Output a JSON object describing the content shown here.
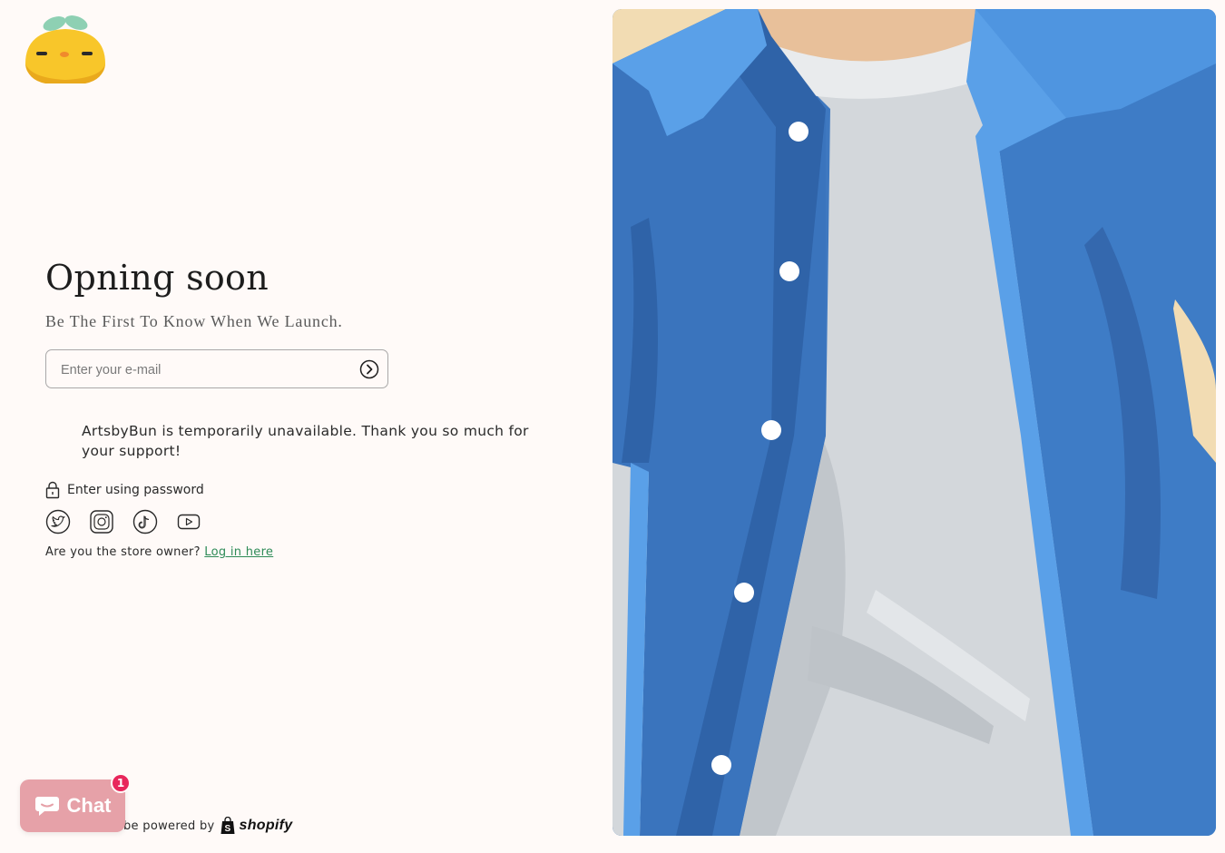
{
  "brand": {
    "logo_icon": "orange-bun-mascot-icon"
  },
  "header": {
    "title": "Opning soon",
    "subtitle": "Be The First To Know When We Launch."
  },
  "newsletter": {
    "placeholder": "Enter your e-mail",
    "submit_icon": "arrow-right-circle-icon"
  },
  "notice": {
    "text": "ArtsbyBun is temporarily unavailable. Thank you so much for your support!"
  },
  "password": {
    "label": "Enter using password",
    "icon": "lock-icon"
  },
  "socials": [
    {
      "name": "twitter",
      "icon": "twitter-icon"
    },
    {
      "name": "instagram",
      "icon": "instagram-icon"
    },
    {
      "name": "tiktok",
      "icon": "tiktok-icon"
    },
    {
      "name": "youtube",
      "icon": "youtube-icon"
    }
  ],
  "owner": {
    "question": "Are you the store owner?",
    "link_label": "Log in here"
  },
  "footer": {
    "powered_text": "be powered by",
    "brand": "shopify"
  },
  "chat": {
    "label": "Chat",
    "badge_count": "1"
  },
  "colors": {
    "page_bg": "#fffaf8",
    "link": "#2e8b57",
    "chat_bg": "#e6a1a8",
    "badge": "#e8265b",
    "jacket_blue": "#4a86cf",
    "shirt_gray": "#d3d7db"
  }
}
